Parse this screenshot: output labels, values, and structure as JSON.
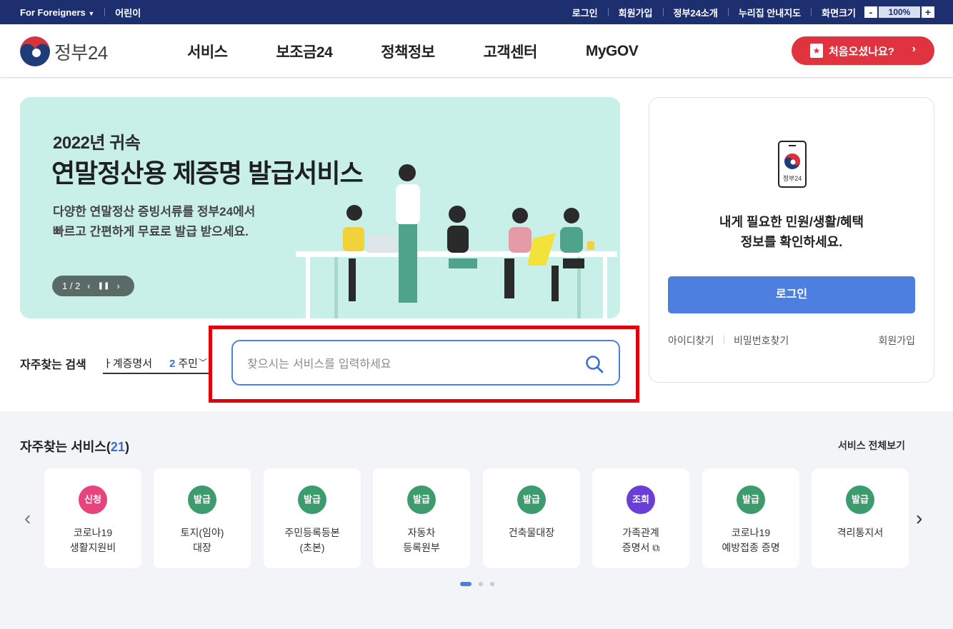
{
  "utility": {
    "foreigners": "For Foreigners",
    "kids": "어린이",
    "login": "로그인",
    "join": "회원가입",
    "about": "정부24소개",
    "sitemap": "누리집 안내지도",
    "screen_size": "화면크기",
    "zoom_minus": "-",
    "zoom_value": "100%",
    "zoom_plus": "+"
  },
  "header": {
    "logo_text": "정부24",
    "nav": [
      "서비스",
      "보조금24",
      "정책정보",
      "고객센터",
      "MyGOV"
    ],
    "first_visit": "처음오셨나요?"
  },
  "banner": {
    "year": "2022년 귀속",
    "title": "연말정산용 제증명 발급서비스",
    "desc1": "다양한 연말정산 증빙서류를 정부24에서",
    "desc2": "빠르고 간편하게 무료로 발급 받으세요.",
    "pager": "1 / 2"
  },
  "login_card": {
    "phone_label": "정부24",
    "msg1": "내게 필요한 민원/생활/혜택",
    "msg2": "정보를 확인하세요.",
    "login_button": "로그인",
    "find_id": "아이디찾기",
    "find_pw": "비밀번호찾기",
    "join": "회원가입"
  },
  "search": {
    "label": "자주찾는 검색",
    "roll_1": "ㅏ계증명서",
    "roll_2_num": "2",
    "roll_2_text": "주민",
    "placeholder": "찾으시는 서비스를 입력하세요"
  },
  "services": {
    "title": "자주찾는 서비스(",
    "count": "21",
    "title_end": ")",
    "view_all": "서비스 전체보기",
    "items": [
      {
        "badge": "신청",
        "color": "#e7437c",
        "l1": "코로나19",
        "l2": "생활지원비"
      },
      {
        "badge": "발급",
        "color": "#3d9c6e",
        "l1": "토지(임야)",
        "l2": "대장"
      },
      {
        "badge": "발급",
        "color": "#3d9c6e",
        "l1": "주민등록등본",
        "l2": "(초본)"
      },
      {
        "badge": "발급",
        "color": "#3d9c6e",
        "l1": "자동차",
        "l2": "등록원부"
      },
      {
        "badge": "발급",
        "color": "#3d9c6e",
        "l1": "건축물대장",
        "l2": ""
      },
      {
        "badge": "조회",
        "color": "#6a3fd8",
        "l1": "가족관계",
        "l2": "증명서 ⧉"
      },
      {
        "badge": "발급",
        "color": "#3d9c6e",
        "l1": "코로나19",
        "l2": "예방접종 증명"
      },
      {
        "badge": "발급",
        "color": "#3d9c6e",
        "l1": "격리통지서",
        "l2": ""
      }
    ]
  }
}
